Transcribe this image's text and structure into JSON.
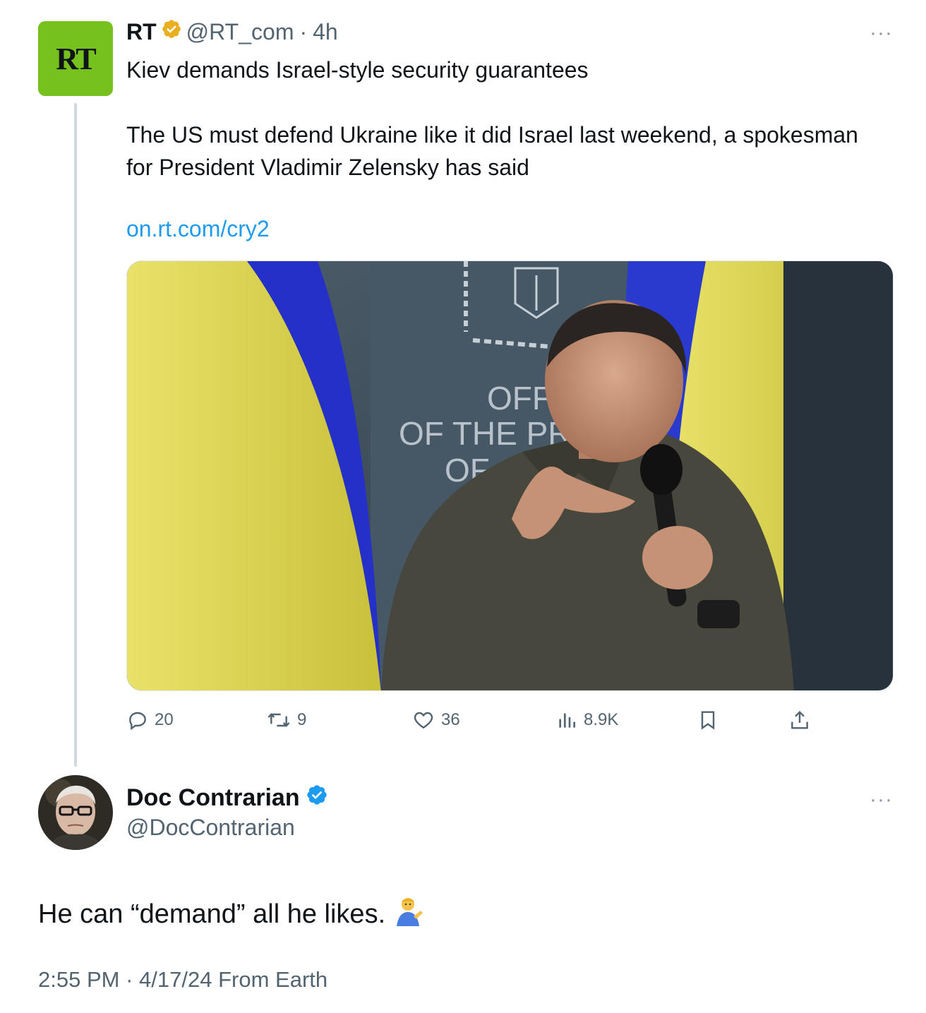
{
  "quoted_tweet": {
    "avatar_text": "RT",
    "author_name": "RT",
    "handle": "@RT_com",
    "separator": "·",
    "time": "4h",
    "more": "···",
    "headline": "Kiev demands Israel-style security guarantees",
    "body": "The US must defend Ukraine like it did Israel last weekend, a spokesman for President Vladimir Zelensky has said",
    "link": "on.rt.com/cry2",
    "media_text_line1": "OFFIC",
    "media_text_line2": "OF THE PRE",
    "media_text_line3": "OF",
    "stats": {
      "replies": "20",
      "reposts": "9",
      "likes": "36",
      "views": "8.9K"
    }
  },
  "reply": {
    "author_name": "Doc Contrarian",
    "handle": "@DocContrarian",
    "more": "···",
    "text": "He can “demand” all he likes.",
    "emoji": "💁‍♂️",
    "timestamp": "2:55 PM",
    "separator": "·",
    "date": "4/17/24",
    "source": "From Earth"
  },
  "colors": {
    "link": "#1d9bf0",
    "rt_green": "#77c11e",
    "verified_gold": "#e8b020",
    "verified_blue": "#1d9bf0",
    "muted": "#536471"
  }
}
